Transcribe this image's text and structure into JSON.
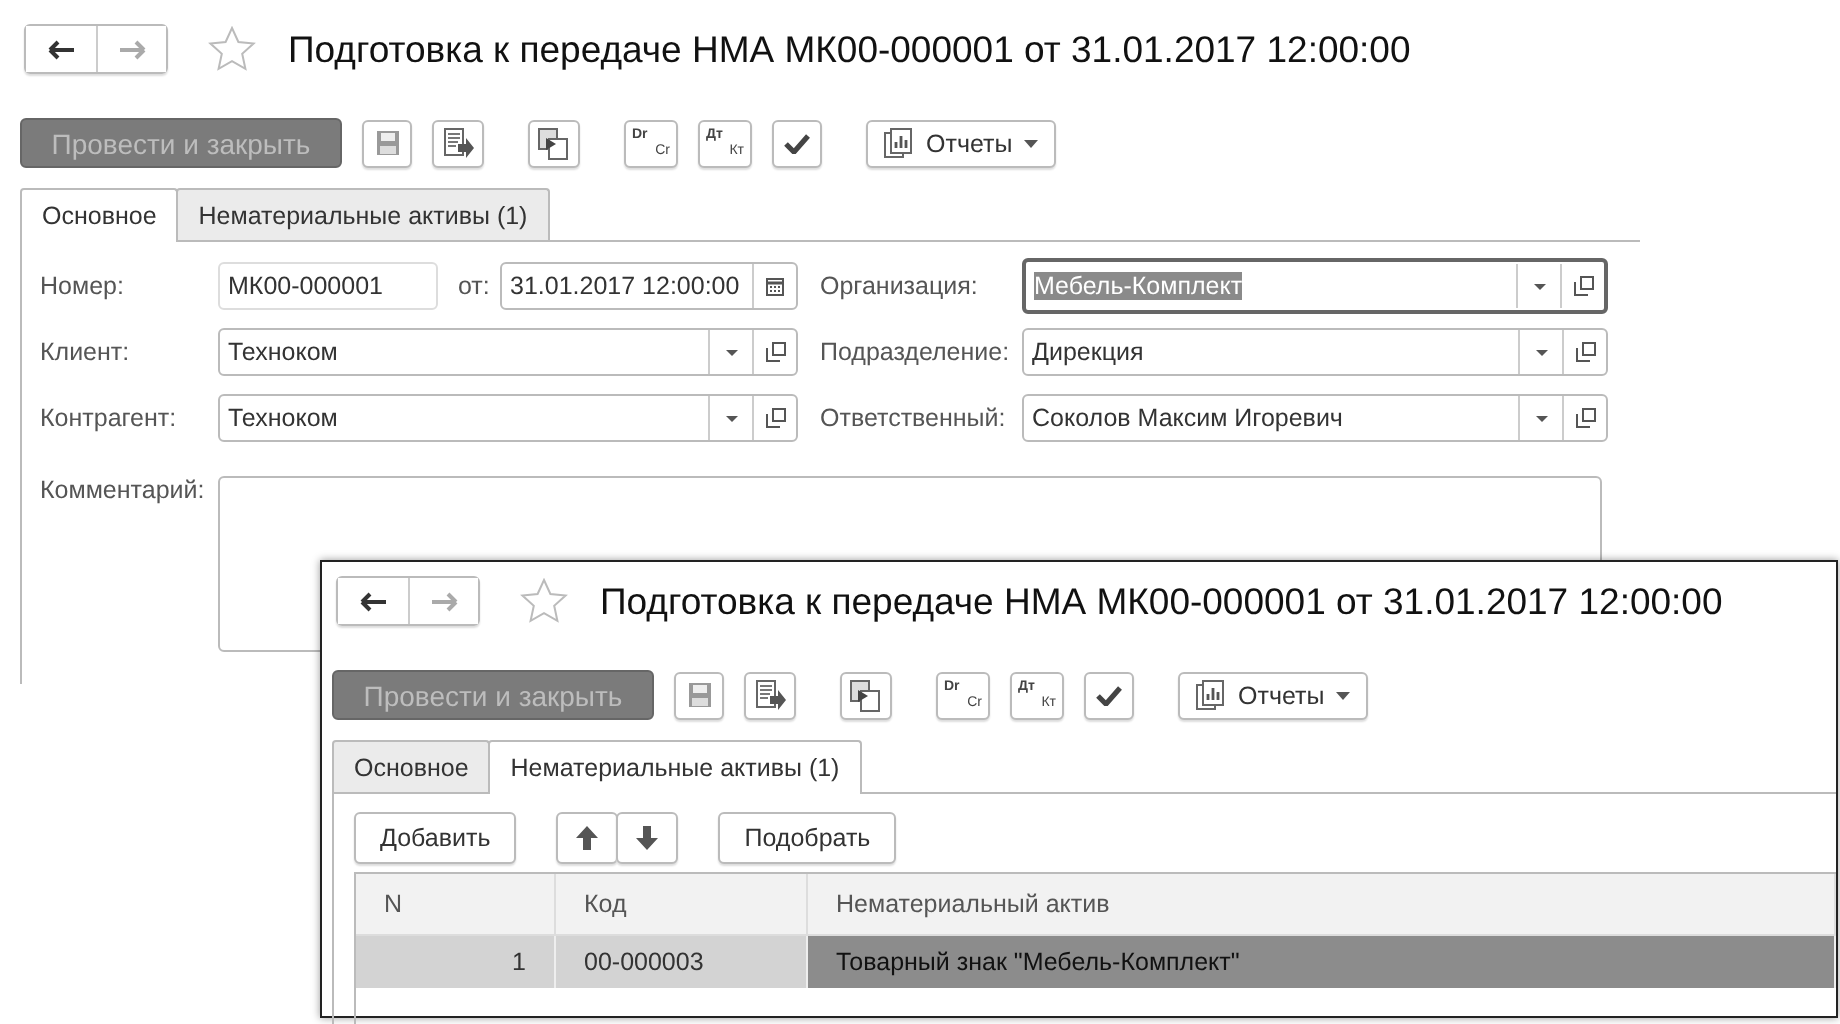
{
  "windows": [
    {
      "title": "Подготовка к передаче НМА МК00-000001 от 31.01.2017 12:00:00",
      "nav": {
        "back": {
          "disabled": false
        },
        "forward": {
          "disabled": true
        }
      },
      "toolbar": {
        "primary": "Провести и закрыть",
        "tools": [
          {
            "kind": "save"
          },
          {
            "kind": "post"
          },
          {
            "kind": "copy"
          },
          {
            "kind": "journal",
            "top": "Dr",
            "bottom": "Cr"
          },
          {
            "kind": "journal",
            "top": "Дт",
            "bottom": "Кт"
          },
          {
            "kind": "check"
          }
        ],
        "reports": "Отчеты"
      },
      "tabs": [
        {
          "label": "Основное",
          "selected": true
        },
        {
          "label": "Нематериальные активы (1)",
          "selected": false
        }
      ],
      "form": {
        "number": {
          "label": "Номер:",
          "value": "МК00-000001"
        },
        "date": {
          "label": "от:",
          "value": "31.01.2017 12:00:00"
        },
        "left": [
          {
            "label": "Клиент:",
            "value": "Техноком",
            "focused": false
          },
          {
            "label": "Контрагент:",
            "value": "Техноком",
            "focused": false
          }
        ],
        "right": [
          {
            "label": "Организация:",
            "value": "Мебель-Комплект",
            "focused": true
          },
          {
            "label": "Подразделение:",
            "value": "Дирекция",
            "focused": false
          },
          {
            "label": "Ответственный:",
            "value": "Соколов Максим Игоревич",
            "focused": false
          }
        ],
        "comment": {
          "label": "Комментарий:"
        }
      }
    },
    {
      "title": "Подготовка к передаче НМА МК00-000001 от 31.01.2017 12:00:00",
      "nav": {
        "back": {
          "disabled": false
        },
        "forward": {
          "disabled": true
        }
      },
      "toolbar": {
        "primary": "Провести и закрыть",
        "tools": [
          {
            "kind": "save"
          },
          {
            "kind": "post"
          },
          {
            "kind": "copy"
          },
          {
            "kind": "journal",
            "top": "Dr",
            "bottom": "Cr"
          },
          {
            "kind": "journal",
            "top": "Дт",
            "bottom": "Кт"
          },
          {
            "kind": "check"
          }
        ],
        "reports": "Отчеты"
      },
      "tabs": [
        {
          "label": "Основное",
          "selected": false
        },
        {
          "label": "Нематериальные активы (1)",
          "selected": true
        }
      ],
      "table": {
        "add": "Добавить",
        "pick": "Подобрать",
        "columns": [
          "N",
          "Код",
          "Нематериальный актив"
        ],
        "rows": [
          {
            "cells": [
              "1",
              "00-000003",
              "Товарный знак \"Мебель-Комплект\""
            ],
            "selected": true
          }
        ]
      }
    }
  ]
}
